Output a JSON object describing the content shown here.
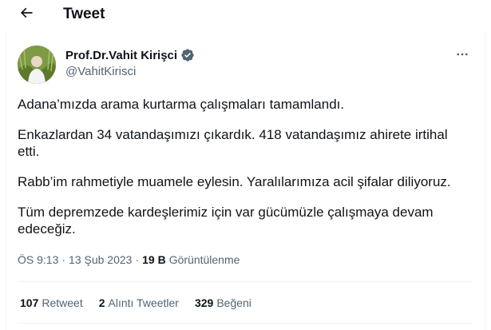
{
  "header": {
    "back_icon": "arrow-left-icon",
    "title": "Tweet"
  },
  "author": {
    "display_name": "Prof.Dr.Vahit Kirişci",
    "handle": "@VahitKirisci",
    "verified_icon": "verified-badge-icon",
    "verified_color": "#1d9bf0"
  },
  "tweet": {
    "paragraphs": [
      "Adana’mızda arama kurtarma çalışmaları tamamlandı.",
      "Enkazlardan 34 vatandaşımızı çıkardık. 418 vatandaşımız ahirete irtihal etti.",
      "Rabb’im rahmetiyle muamele eylesin. Yaralılarımıza acil şifalar diliyoruz.",
      "Tüm depremzede kardeşlerimiz için var gücümüzle çalışmaya devam edeceğiz."
    ],
    "time": "ÖS 9:13",
    "date": "13 Şub 2023",
    "views_count": "19 B",
    "views_label": "Görüntülenme"
  },
  "stats": {
    "retweets_count": "107",
    "retweets_label": "Retweet",
    "quotes_count": "2",
    "quotes_label": "Alıntı Tweetler",
    "likes_count": "329",
    "likes_label": "Beğeni"
  },
  "more_icon": "more-dots-icon",
  "colors": {
    "text_primary": "#0f1419",
    "text_secondary": "#536471",
    "border": "#eff3f4"
  }
}
